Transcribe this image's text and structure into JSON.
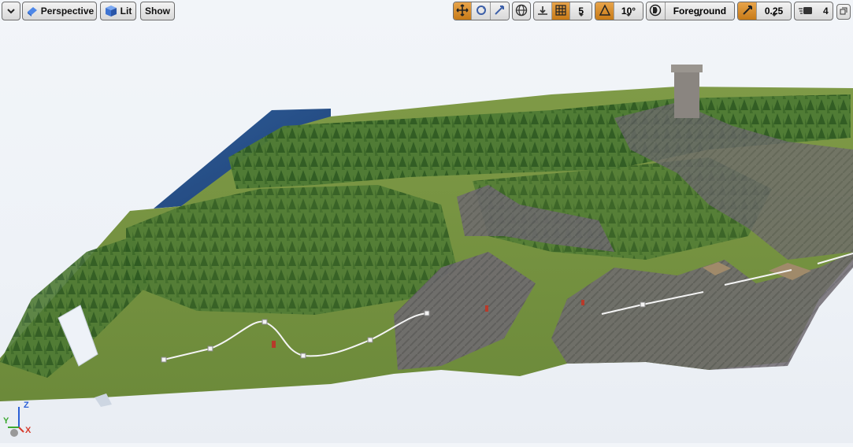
{
  "toolbar": {
    "menu_icon": "chevron-down-icon",
    "view_mode_label": "Perspective",
    "view_mode_icon": "perspective-cube-icon",
    "lighting_label": "Lit",
    "lighting_icon": "lit-cube-icon",
    "show_label": "Show",
    "grid_snap_value": "5",
    "rotation_snap_value": "10°",
    "camera_layer_label": "Foreground",
    "scale_snap_value": "0.25",
    "camera_speed_value": "4",
    "accent_color": "#d98d28"
  },
  "axis_gizmo": {
    "z_label": "Z",
    "y_label": "Y",
    "x_label": "X"
  }
}
